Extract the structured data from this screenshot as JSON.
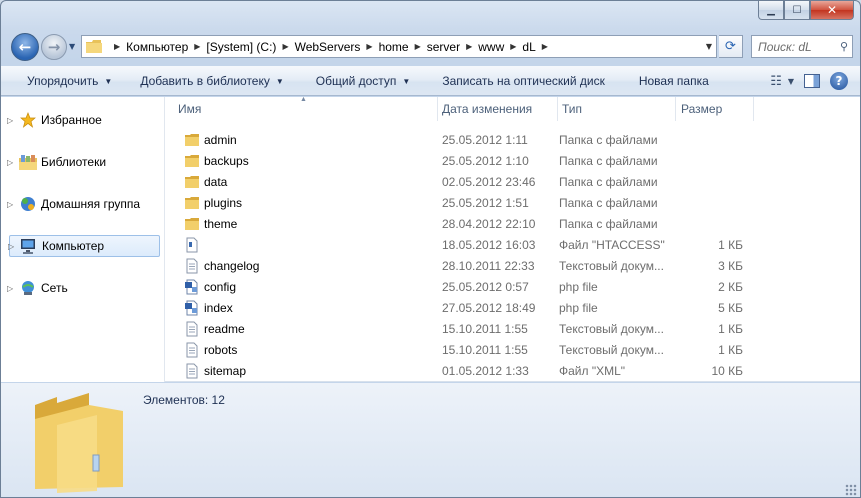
{
  "address": {
    "crumbs": [
      "Компьютер",
      "[System] (C:)",
      "WebServers",
      "home",
      "server",
      "www",
      "dL"
    ]
  },
  "search": {
    "placeholder": "Поиск: dL"
  },
  "commands": {
    "organize": "Упорядочить",
    "add_to_library": "Добавить в библиотеку",
    "share": "Общий доступ",
    "burn": "Записать на оптический диск",
    "new_folder": "Новая папка"
  },
  "navpane": {
    "items": [
      {
        "label": "Избранное",
        "icon": "star-icon"
      },
      {
        "label": "Библиотеки",
        "icon": "library-icon"
      },
      {
        "label": "Домашняя группа",
        "icon": "homegroup-icon"
      },
      {
        "label": "Компьютер",
        "icon": "computer-icon",
        "selected": true
      },
      {
        "label": "Сеть",
        "icon": "network-icon"
      }
    ]
  },
  "columns": {
    "name": "Имя",
    "date": "Дата изменения",
    "type": "Тип",
    "size": "Размер"
  },
  "files": [
    {
      "name": "admin",
      "date": "25.05.2012 1:11",
      "type": "Папка с файлами",
      "size": "",
      "icon": "folder"
    },
    {
      "name": "backups",
      "date": "25.05.2012 1:10",
      "type": "Папка с файлами",
      "size": "",
      "icon": "folder"
    },
    {
      "name": "data",
      "date": "02.05.2012 23:46",
      "type": "Папка с файлами",
      "size": "",
      "icon": "folder"
    },
    {
      "name": "plugins",
      "date": "25.05.2012 1:51",
      "type": "Папка с файлами",
      "size": "",
      "icon": "folder"
    },
    {
      "name": "theme",
      "date": "28.04.2012 22:10",
      "type": "Папка с файлами",
      "size": "",
      "icon": "folder"
    },
    {
      "name": "",
      "date": "18.05.2012 16:03",
      "type": "Файл \"HTACCESS\"",
      "size": "1 КБ",
      "icon": "file"
    },
    {
      "name": "changelog",
      "date": "28.10.2011 22:33",
      "type": "Текстовый докум...",
      "size": "3 КБ",
      "icon": "text"
    },
    {
      "name": "config",
      "date": "25.05.2012 0:57",
      "type": "php file",
      "size": "2 КБ",
      "icon": "php"
    },
    {
      "name": "index",
      "date": "27.05.2012 18:49",
      "type": "php file",
      "size": "5 КБ",
      "icon": "php"
    },
    {
      "name": "readme",
      "date": "15.10.2011 1:55",
      "type": "Текстовый докум...",
      "size": "1 КБ",
      "icon": "text"
    },
    {
      "name": "robots",
      "date": "15.10.2011 1:55",
      "type": "Текстовый докум...",
      "size": "1 КБ",
      "icon": "text"
    },
    {
      "name": "sitemap",
      "date": "01.05.2012 1:33",
      "type": "Файл \"XML\"",
      "size": "10 КБ",
      "icon": "text"
    }
  ],
  "details": {
    "count": "Элементов: 12"
  }
}
